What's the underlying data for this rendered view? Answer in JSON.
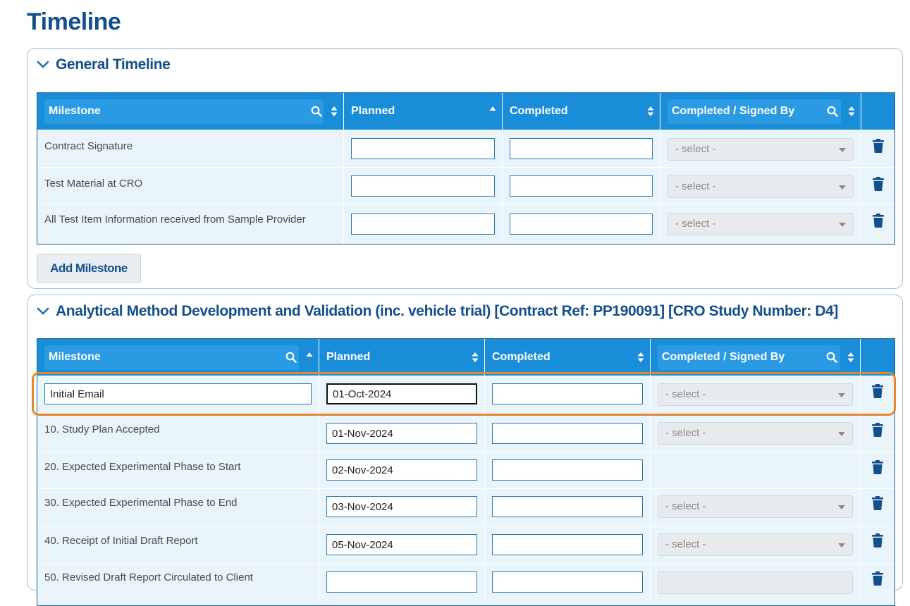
{
  "page": {
    "title": "Timeline"
  },
  "colors": {
    "header_blue": "#1a8dd8",
    "title_blue": "#134f8c",
    "highlight_orange": "#e8862f",
    "row_bg": "#e9f4fb"
  },
  "general": {
    "title": "General Timeline",
    "columns": {
      "milestone": "Milestone",
      "planned": "Planned",
      "completed": "Completed",
      "signed": "Completed / Signed By"
    },
    "rows": [
      {
        "milestone": "Contract Signature",
        "planned": "",
        "completed": "",
        "signed": "- select -"
      },
      {
        "milestone": "Test Material at CRO",
        "planned": "",
        "completed": "",
        "signed": "- select -"
      },
      {
        "milestone": "All Test Item Information received from Sample Provider",
        "planned": "",
        "completed": "",
        "signed": "- select -"
      }
    ],
    "add_label": "Add Milestone"
  },
  "analytical": {
    "title": "Analytical Method Development and Validation (inc. vehicle trial) [Contract Ref: PP190091] [CRO Study Number: D4]",
    "columns": {
      "milestone": "Milestone",
      "planned": "Planned",
      "completed": "Completed",
      "signed": "Completed / Signed By"
    },
    "editing_row": {
      "milestone": "Initial Email",
      "planned": "01-Oct-2024",
      "completed": "",
      "signed": "- select -"
    },
    "rows": [
      {
        "milestone": "10. Study Plan Accepted",
        "planned": "01-Nov-2024",
        "completed": "",
        "signed": "- select -"
      },
      {
        "milestone": "20. Expected Experimental Phase to Start",
        "planned": "02-Nov-2024",
        "completed": "",
        "signed": ""
      },
      {
        "milestone": "30. Expected Experimental Phase to End",
        "planned": "03-Nov-2024",
        "completed": "",
        "signed": "- select -"
      },
      {
        "milestone": "40. Receipt of Initial Draft Report",
        "planned": "05-Nov-2024",
        "completed": "",
        "signed": "- select -"
      },
      {
        "milestone": "50. Revised Draft Report Circulated to Client",
        "planned": "",
        "completed": "",
        "signed": ""
      }
    ]
  },
  "icons": {
    "chevron": "chevron-down-icon",
    "search": "search-icon",
    "sort": "sort-icon",
    "delete": "trash-icon"
  }
}
